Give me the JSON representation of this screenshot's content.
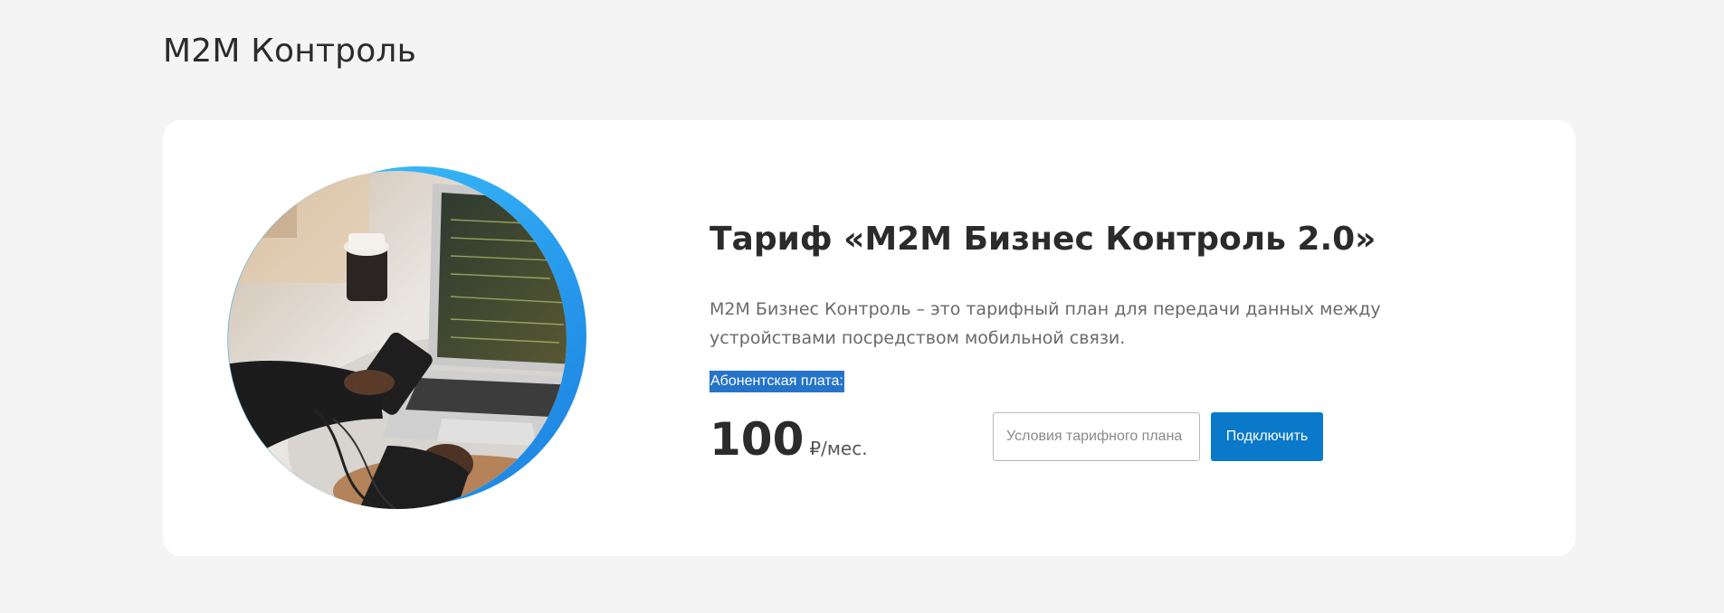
{
  "page": {
    "title": "M2M Контроль"
  },
  "tariff": {
    "title": "Тариф «M2M Бизнес Контроль 2.0»",
    "description": "M2M Бизнес Контроль – это тарифный план для передачи данных между устройствами посредством мобильной связи.",
    "fee_label": "Абонентская плата:",
    "price_value": "100",
    "price_unit": "₽/мес.",
    "terms_placeholder": "Условия тарифного плана",
    "connect_label": "Подключить"
  },
  "colors": {
    "background": "#f4f4f4",
    "card": "#ffffff",
    "accent": "#0a79c9",
    "selection": "#2574c9",
    "ring": "#1fb0f5"
  },
  "illustration": {
    "icon": "laptop-photo"
  }
}
